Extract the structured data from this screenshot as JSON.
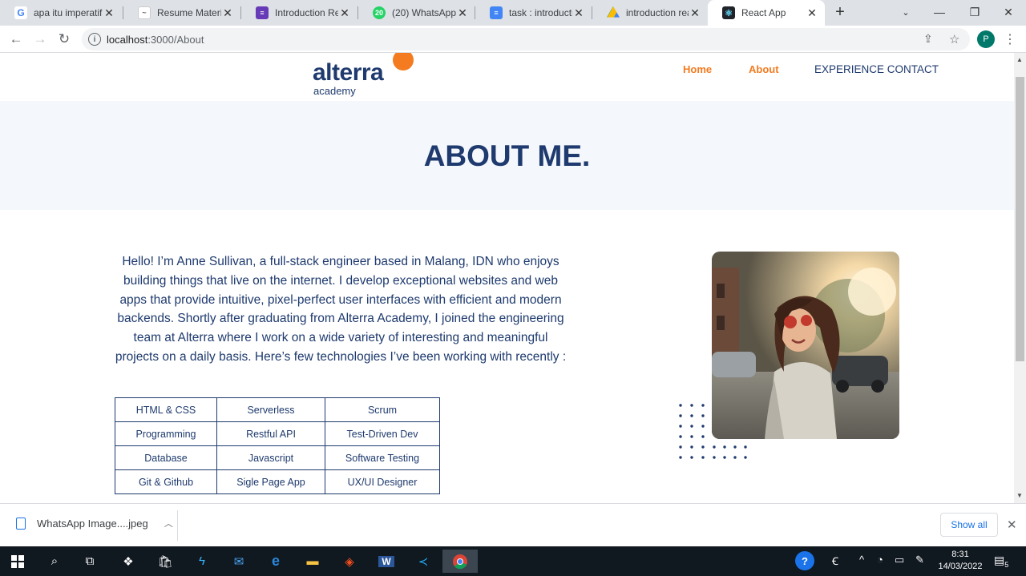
{
  "browser": {
    "tabs": [
      {
        "title": "apa itu imperatif",
        "icon": "google-icon",
        "color": "#4285f4"
      },
      {
        "title": "Resume Materi",
        "icon": "trend-icon",
        "color": "#5f6368"
      },
      {
        "title": "Introduction Rea",
        "icon": "forms-icon",
        "color": "#673ab7"
      },
      {
        "title": "(20) WhatsApp",
        "icon": "whatsapp-icon",
        "color": "#25d366",
        "badge": "20"
      },
      {
        "title": "task : introductio",
        "icon": "docs-icon",
        "color": "#4285f4"
      },
      {
        "title": "introduction rea",
        "icon": "drive-icon",
        "color": "#fbbc04"
      },
      {
        "title": "React App",
        "icon": "react-icon",
        "color": "#20232a"
      }
    ],
    "url_host": "localhost",
    "url_path": ":3000/About",
    "profile_initial": "P"
  },
  "page": {
    "logo": {
      "word": "alterra",
      "sub": "academy",
      "accent": "#f47b20",
      "navy": "#1e3a6e"
    },
    "nav": [
      {
        "label": "Home",
        "color": "#f47b20"
      },
      {
        "label": "About",
        "color": "#f47b20"
      },
      {
        "label": "EXPERIENCE CONTACT",
        "color": "#1e3a6e"
      }
    ],
    "hero_title": "ABOUT ME.",
    "bio": "Hello! I’m Anne Sullivan, a full-stack engineer based in Malang, IDN who enjoys building things that live on the internet. I develop exceptional websites and web apps that provide intuitive, pixel-perfect user interfaces with efficient and modern backends. Shortly after graduating from Alterra Academy, I joined the engineering team at Alterra where I work on a wide variety of interesting and meaningful projects on a daily basis. Here’s few technologies I’ve been working with recently :",
    "skills": [
      [
        "HTML & CSS",
        "Serverless",
        "Scrum"
      ],
      [
        "Programming",
        "Restful API",
        "Test-Driven Dev"
      ],
      [
        "Database",
        "Javascript",
        "Software Testing"
      ],
      [
        "Git & Github",
        "Sigle Page App",
        "UX/UI Designer"
      ]
    ]
  },
  "downloads": {
    "file": "WhatsApp Image....jpeg",
    "show_all": "Show all"
  },
  "taskbar": {
    "time": "8:31",
    "date": "14/03/2022",
    "notifications": "5"
  }
}
